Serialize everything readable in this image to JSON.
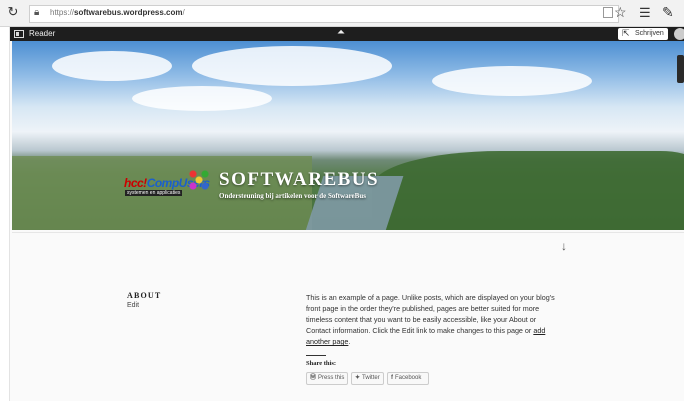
{
  "browser": {
    "url_prefix": "https://",
    "url_host": "softwarebus.wordpress.com",
    "url_suffix": "/"
  },
  "wpbar": {
    "reader_label": "Reader",
    "write_label": "Schrijven"
  },
  "site": {
    "title": "SOFTWAREBUS",
    "description": "Ondersteuning bij artikelen voor de SoftwareBus",
    "logo_word1": "hcc!",
    "logo_word2": "CompUsers",
    "logo_sub": "systemen en applicaties"
  },
  "about": {
    "title": "ABOUT",
    "edit_label": "Edit",
    "body_text": "This is an example of a page. Unlike posts, which are displayed on your blog's front page in the order they're published, pages are better suited for more timeless content that you want to be easily accessible, like your About or Contact information. Click the Edit link to make changes to this page or ",
    "body_link": "add another page",
    "body_end": "."
  },
  "share": {
    "title": "Share this:",
    "buttons": [
      {
        "label": "Press this",
        "icon": "wordpress-icon"
      },
      {
        "label": "Twitter",
        "icon": "twitter-icon"
      },
      {
        "label": "Facebook",
        "icon": "facebook-icon"
      }
    ]
  },
  "icons": {
    "reload": "reload-icon",
    "lock": "lock-icon",
    "star": "star-icon",
    "favorites": "favorites-icon",
    "pen": "pen-icon",
    "down_arrow": "arrow-down-icon"
  }
}
